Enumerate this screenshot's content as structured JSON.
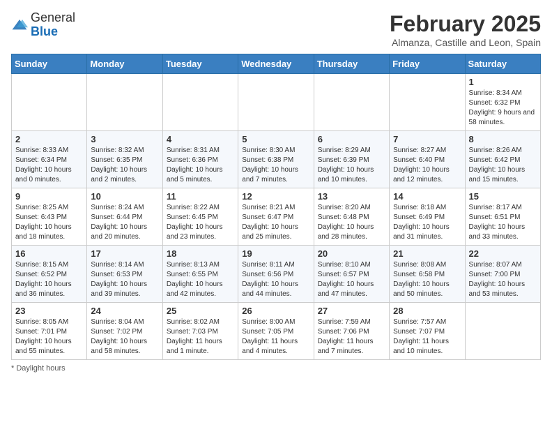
{
  "header": {
    "logo_general": "General",
    "logo_blue": "Blue",
    "month_title": "February 2025",
    "subtitle": "Almanza, Castille and Leon, Spain"
  },
  "days_of_week": [
    "Sunday",
    "Monday",
    "Tuesday",
    "Wednesday",
    "Thursday",
    "Friday",
    "Saturday"
  ],
  "footer": {
    "note": "Daylight hours"
  },
  "weeks": [
    [
      {
        "day": "",
        "info": ""
      },
      {
        "day": "",
        "info": ""
      },
      {
        "day": "",
        "info": ""
      },
      {
        "day": "",
        "info": ""
      },
      {
        "day": "",
        "info": ""
      },
      {
        "day": "",
        "info": ""
      },
      {
        "day": "1",
        "info": "Sunrise: 8:34 AM\nSunset: 6:32 PM\nDaylight: 9 hours and 58 minutes."
      }
    ],
    [
      {
        "day": "2",
        "info": "Sunrise: 8:33 AM\nSunset: 6:34 PM\nDaylight: 10 hours and 0 minutes."
      },
      {
        "day": "3",
        "info": "Sunrise: 8:32 AM\nSunset: 6:35 PM\nDaylight: 10 hours and 2 minutes."
      },
      {
        "day": "4",
        "info": "Sunrise: 8:31 AM\nSunset: 6:36 PM\nDaylight: 10 hours and 5 minutes."
      },
      {
        "day": "5",
        "info": "Sunrise: 8:30 AM\nSunset: 6:38 PM\nDaylight: 10 hours and 7 minutes."
      },
      {
        "day": "6",
        "info": "Sunrise: 8:29 AM\nSunset: 6:39 PM\nDaylight: 10 hours and 10 minutes."
      },
      {
        "day": "7",
        "info": "Sunrise: 8:27 AM\nSunset: 6:40 PM\nDaylight: 10 hours and 12 minutes."
      },
      {
        "day": "8",
        "info": "Sunrise: 8:26 AM\nSunset: 6:42 PM\nDaylight: 10 hours and 15 minutes."
      }
    ],
    [
      {
        "day": "9",
        "info": "Sunrise: 8:25 AM\nSunset: 6:43 PM\nDaylight: 10 hours and 18 minutes."
      },
      {
        "day": "10",
        "info": "Sunrise: 8:24 AM\nSunset: 6:44 PM\nDaylight: 10 hours and 20 minutes."
      },
      {
        "day": "11",
        "info": "Sunrise: 8:22 AM\nSunset: 6:45 PM\nDaylight: 10 hours and 23 minutes."
      },
      {
        "day": "12",
        "info": "Sunrise: 8:21 AM\nSunset: 6:47 PM\nDaylight: 10 hours and 25 minutes."
      },
      {
        "day": "13",
        "info": "Sunrise: 8:20 AM\nSunset: 6:48 PM\nDaylight: 10 hours and 28 minutes."
      },
      {
        "day": "14",
        "info": "Sunrise: 8:18 AM\nSunset: 6:49 PM\nDaylight: 10 hours and 31 minutes."
      },
      {
        "day": "15",
        "info": "Sunrise: 8:17 AM\nSunset: 6:51 PM\nDaylight: 10 hours and 33 minutes."
      }
    ],
    [
      {
        "day": "16",
        "info": "Sunrise: 8:15 AM\nSunset: 6:52 PM\nDaylight: 10 hours and 36 minutes."
      },
      {
        "day": "17",
        "info": "Sunrise: 8:14 AM\nSunset: 6:53 PM\nDaylight: 10 hours and 39 minutes."
      },
      {
        "day": "18",
        "info": "Sunrise: 8:13 AM\nSunset: 6:55 PM\nDaylight: 10 hours and 42 minutes."
      },
      {
        "day": "19",
        "info": "Sunrise: 8:11 AM\nSunset: 6:56 PM\nDaylight: 10 hours and 44 minutes."
      },
      {
        "day": "20",
        "info": "Sunrise: 8:10 AM\nSunset: 6:57 PM\nDaylight: 10 hours and 47 minutes."
      },
      {
        "day": "21",
        "info": "Sunrise: 8:08 AM\nSunset: 6:58 PM\nDaylight: 10 hours and 50 minutes."
      },
      {
        "day": "22",
        "info": "Sunrise: 8:07 AM\nSunset: 7:00 PM\nDaylight: 10 hours and 53 minutes."
      }
    ],
    [
      {
        "day": "23",
        "info": "Sunrise: 8:05 AM\nSunset: 7:01 PM\nDaylight: 10 hours and 55 minutes."
      },
      {
        "day": "24",
        "info": "Sunrise: 8:04 AM\nSunset: 7:02 PM\nDaylight: 10 hours and 58 minutes."
      },
      {
        "day": "25",
        "info": "Sunrise: 8:02 AM\nSunset: 7:03 PM\nDaylight: 11 hours and 1 minute."
      },
      {
        "day": "26",
        "info": "Sunrise: 8:00 AM\nSunset: 7:05 PM\nDaylight: 11 hours and 4 minutes."
      },
      {
        "day": "27",
        "info": "Sunrise: 7:59 AM\nSunset: 7:06 PM\nDaylight: 11 hours and 7 minutes."
      },
      {
        "day": "28",
        "info": "Sunrise: 7:57 AM\nSunset: 7:07 PM\nDaylight: 11 hours and 10 minutes."
      },
      {
        "day": "",
        "info": ""
      }
    ]
  ]
}
